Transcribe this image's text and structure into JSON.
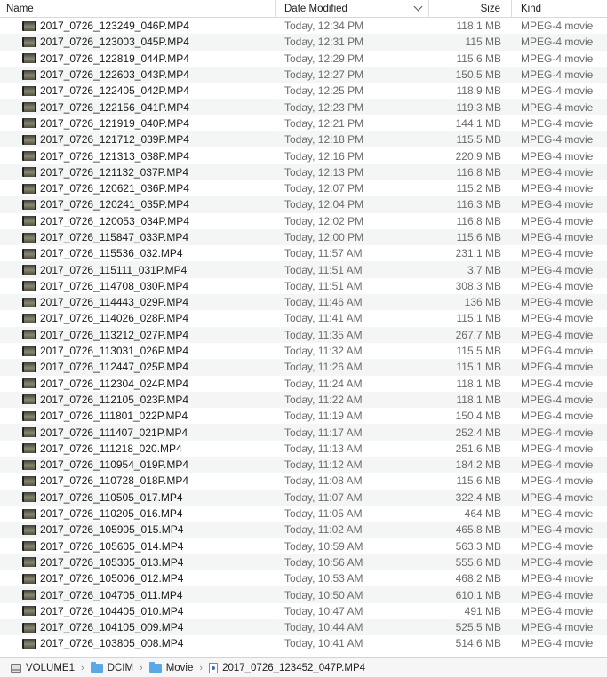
{
  "columns": {
    "name": "Name",
    "date": "Date Modified",
    "size": "Size",
    "kind": "Kind"
  },
  "files": [
    {
      "name": "2017_0726_123249_046P.MP4",
      "date": "Today, 12:34 PM",
      "size": "118.1 MB",
      "kind": "MPEG-4 movie"
    },
    {
      "name": "2017_0726_123003_045P.MP4",
      "date": "Today, 12:31 PM",
      "size": "115 MB",
      "kind": "MPEG-4 movie"
    },
    {
      "name": "2017_0726_122819_044P.MP4",
      "date": "Today, 12:29 PM",
      "size": "115.6 MB",
      "kind": "MPEG-4 movie"
    },
    {
      "name": "2017_0726_122603_043P.MP4",
      "date": "Today, 12:27 PM",
      "size": "150.5 MB",
      "kind": "MPEG-4 movie"
    },
    {
      "name": "2017_0726_122405_042P.MP4",
      "date": "Today, 12:25 PM",
      "size": "118.9 MB",
      "kind": "MPEG-4 movie"
    },
    {
      "name": "2017_0726_122156_041P.MP4",
      "date": "Today, 12:23 PM",
      "size": "119.3 MB",
      "kind": "MPEG-4 movie"
    },
    {
      "name": "2017_0726_121919_040P.MP4",
      "date": "Today, 12:21 PM",
      "size": "144.1 MB",
      "kind": "MPEG-4 movie"
    },
    {
      "name": "2017_0726_121712_039P.MP4",
      "date": "Today, 12:18 PM",
      "size": "115.5 MB",
      "kind": "MPEG-4 movie"
    },
    {
      "name": "2017_0726_121313_038P.MP4",
      "date": "Today, 12:16 PM",
      "size": "220.9 MB",
      "kind": "MPEG-4 movie"
    },
    {
      "name": "2017_0726_121132_037P.MP4",
      "date": "Today, 12:13 PM",
      "size": "116.8 MB",
      "kind": "MPEG-4 movie"
    },
    {
      "name": "2017_0726_120621_036P.MP4",
      "date": "Today, 12:07 PM",
      "size": "115.2 MB",
      "kind": "MPEG-4 movie"
    },
    {
      "name": "2017_0726_120241_035P.MP4",
      "date": "Today, 12:04 PM",
      "size": "116.3 MB",
      "kind": "MPEG-4 movie"
    },
    {
      "name": "2017_0726_120053_034P.MP4",
      "date": "Today, 12:02 PM",
      "size": "116.8 MB",
      "kind": "MPEG-4 movie"
    },
    {
      "name": "2017_0726_115847_033P.MP4",
      "date": "Today, 12:00 PM",
      "size": "115.6 MB",
      "kind": "MPEG-4 movie"
    },
    {
      "name": "2017_0726_115536_032.MP4",
      "date": "Today, 11:57 AM",
      "size": "231.1 MB",
      "kind": "MPEG-4 movie"
    },
    {
      "name": "2017_0726_115111_031P.MP4",
      "date": "Today, 11:51 AM",
      "size": "3.7 MB",
      "kind": "MPEG-4 movie"
    },
    {
      "name": "2017_0726_114708_030P.MP4",
      "date": "Today, 11:51 AM",
      "size": "308.3 MB",
      "kind": "MPEG-4 movie"
    },
    {
      "name": "2017_0726_114443_029P.MP4",
      "date": "Today, 11:46 AM",
      "size": "136 MB",
      "kind": "MPEG-4 movie"
    },
    {
      "name": "2017_0726_114026_028P.MP4",
      "date": "Today, 11:41 AM",
      "size": "115.1 MB",
      "kind": "MPEG-4 movie"
    },
    {
      "name": "2017_0726_113212_027P.MP4",
      "date": "Today, 11:35 AM",
      "size": "267.7 MB",
      "kind": "MPEG-4 movie"
    },
    {
      "name": "2017_0726_113031_026P.MP4",
      "date": "Today, 11:32 AM",
      "size": "115.5 MB",
      "kind": "MPEG-4 movie"
    },
    {
      "name": "2017_0726_112447_025P.MP4",
      "date": "Today, 11:26 AM",
      "size": "115.1 MB",
      "kind": "MPEG-4 movie"
    },
    {
      "name": "2017_0726_112304_024P.MP4",
      "date": "Today, 11:24 AM",
      "size": "118.1 MB",
      "kind": "MPEG-4 movie"
    },
    {
      "name": "2017_0726_112105_023P.MP4",
      "date": "Today, 11:22 AM",
      "size": "118.1 MB",
      "kind": "MPEG-4 movie"
    },
    {
      "name": "2017_0726_111801_022P.MP4",
      "date": "Today, 11:19 AM",
      "size": "150.4 MB",
      "kind": "MPEG-4 movie"
    },
    {
      "name": "2017_0726_111407_021P.MP4",
      "date": "Today, 11:17 AM",
      "size": "252.4 MB",
      "kind": "MPEG-4 movie"
    },
    {
      "name": "2017_0726_111218_020.MP4",
      "date": "Today, 11:13 AM",
      "size": "251.6 MB",
      "kind": "MPEG-4 movie"
    },
    {
      "name": "2017_0726_110954_019P.MP4",
      "date": "Today, 11:12 AM",
      "size": "184.2 MB",
      "kind": "MPEG-4 movie"
    },
    {
      "name": "2017_0726_110728_018P.MP4",
      "date": "Today, 11:08 AM",
      "size": "115.6 MB",
      "kind": "MPEG-4 movie"
    },
    {
      "name": "2017_0726_110505_017.MP4",
      "date": "Today, 11:07 AM",
      "size": "322.4 MB",
      "kind": "MPEG-4 movie"
    },
    {
      "name": "2017_0726_110205_016.MP4",
      "date": "Today, 11:05 AM",
      "size": "464 MB",
      "kind": "MPEG-4 movie"
    },
    {
      "name": "2017_0726_105905_015.MP4",
      "date": "Today, 11:02 AM",
      "size": "465.8 MB",
      "kind": "MPEG-4 movie"
    },
    {
      "name": "2017_0726_105605_014.MP4",
      "date": "Today, 10:59 AM",
      "size": "563.3 MB",
      "kind": "MPEG-4 movie"
    },
    {
      "name": "2017_0726_105305_013.MP4",
      "date": "Today, 10:56 AM",
      "size": "555.6 MB",
      "kind": "MPEG-4 movie"
    },
    {
      "name": "2017_0726_105006_012.MP4",
      "date": "Today, 10:53 AM",
      "size": "468.2 MB",
      "kind": "MPEG-4 movie"
    },
    {
      "name": "2017_0726_104705_011.MP4",
      "date": "Today, 10:50 AM",
      "size": "610.1 MB",
      "kind": "MPEG-4 movie"
    },
    {
      "name": "2017_0726_104405_010.MP4",
      "date": "Today, 10:47 AM",
      "size": "491 MB",
      "kind": "MPEG-4 movie"
    },
    {
      "name": "2017_0726_104105_009.MP4",
      "date": "Today, 10:44 AM",
      "size": "525.5 MB",
      "kind": "MPEG-4 movie"
    },
    {
      "name": "2017_0726_103805_008.MP4",
      "date": "Today, 10:41 AM",
      "size": "514.6 MB",
      "kind": "MPEG-4 movie"
    }
  ],
  "pathbar": {
    "volume": "VOLUME1",
    "folder1": "DCIM",
    "folder2": "Movie",
    "file": "2017_0726_123452_047P.MP4",
    "separator": "›"
  },
  "icons": {
    "file_thumb": "video-thumbnail-icon",
    "sort": "chevron-down-icon",
    "volume": "disk-icon",
    "folder": "folder-icon",
    "file": "movie-file-icon"
  },
  "colors": {
    "folder": "#5aa9e6",
    "zebra": "#f4f5f5",
    "secondary_text": "#6b6b6b"
  }
}
